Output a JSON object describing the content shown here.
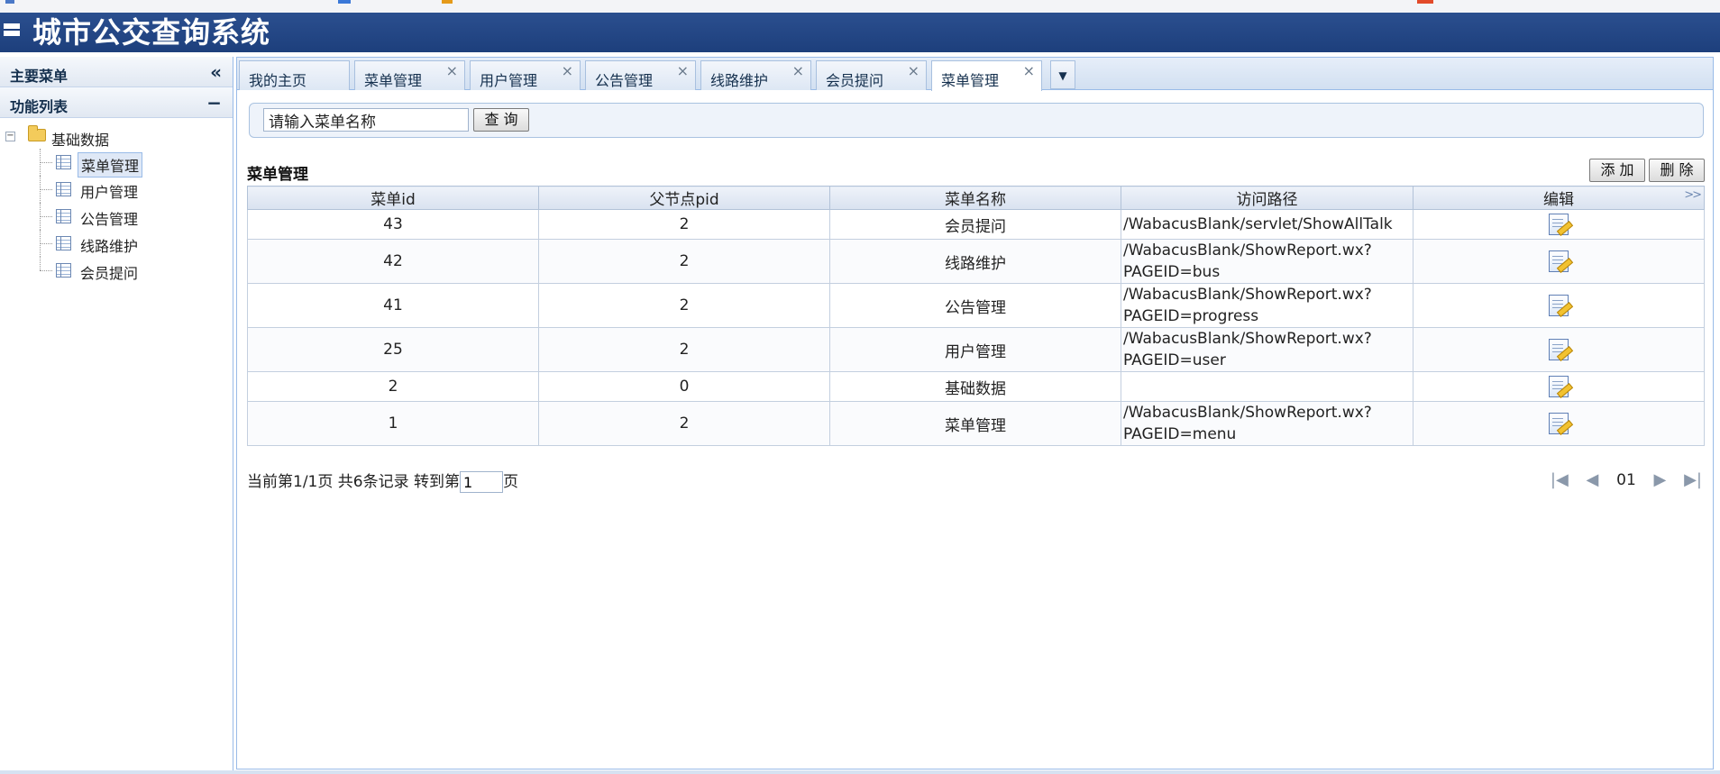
{
  "app": {
    "title": "城市公交查询系统"
  },
  "sidebar": {
    "main_menu_label": "主要菜单",
    "collapse_icon": "«",
    "function_list_label": "功能列表",
    "function_list_toggle": "−",
    "tree_root": "基础数据",
    "items": [
      {
        "label": "菜单管理",
        "selected": true
      },
      {
        "label": "用户管理"
      },
      {
        "label": "公告管理"
      },
      {
        "label": "线路维护"
      },
      {
        "label": "会员提问"
      }
    ]
  },
  "tabs": [
    {
      "label": "我的主页",
      "closable": false
    },
    {
      "label": "菜单管理",
      "closable": true
    },
    {
      "label": "用户管理",
      "closable": true
    },
    {
      "label": "公告管理",
      "closable": true
    },
    {
      "label": "线路维护",
      "closable": true
    },
    {
      "label": "会员提问",
      "closable": true
    },
    {
      "label": "菜单管理",
      "closable": true,
      "active": true
    }
  ],
  "tab_close_glyph": "×",
  "tab_menu_glyph": "▼",
  "search": {
    "value": "请输入菜单名称",
    "button": "查 询"
  },
  "report": {
    "title": "菜单管理",
    "add_button": "添 加",
    "delete_button": "删 除",
    "columns": [
      "菜单id",
      "父节点pid",
      "菜单名称",
      "访问路径",
      "编辑"
    ],
    "rows": [
      {
        "id": "43",
        "pid": "2",
        "name": "会员提问",
        "path": [
          "/WabacusBlank/servlet/ShowAllTalk"
        ]
      },
      {
        "id": "42",
        "pid": "2",
        "name": "线路维护",
        "path": [
          "/WabacusBlank/ShowReport.wx?",
          "PAGEID=bus"
        ]
      },
      {
        "id": "41",
        "pid": "2",
        "name": "公告管理",
        "path": [
          "/WabacusBlank/ShowReport.wx?",
          "PAGEID=progress"
        ]
      },
      {
        "id": "25",
        "pid": "2",
        "name": "用户管理",
        "path": [
          "/WabacusBlank/ShowReport.wx?",
          "PAGEID=user"
        ]
      },
      {
        "id": "2",
        "pid": "0",
        "name": "基础数据",
        "path": []
      },
      {
        "id": "1",
        "pid": "2",
        "name": "菜单管理",
        "path": [
          "/WabacusBlank/ShowReport.wx?",
          "PAGEID=menu"
        ]
      }
    ]
  },
  "pager": {
    "text_before": "当前第1/1页 共6条记录 转到第",
    "goto_value": "1",
    "text_after": "页",
    "page_number": "01",
    "icons": [
      "first-page-icon",
      "prev-page-icon",
      "next-page-icon",
      "last-page-icon"
    ]
  },
  "colors": {
    "banner": "#1d3f7c",
    "border": "#99bbe8",
    "header": "#d9e2f0"
  }
}
